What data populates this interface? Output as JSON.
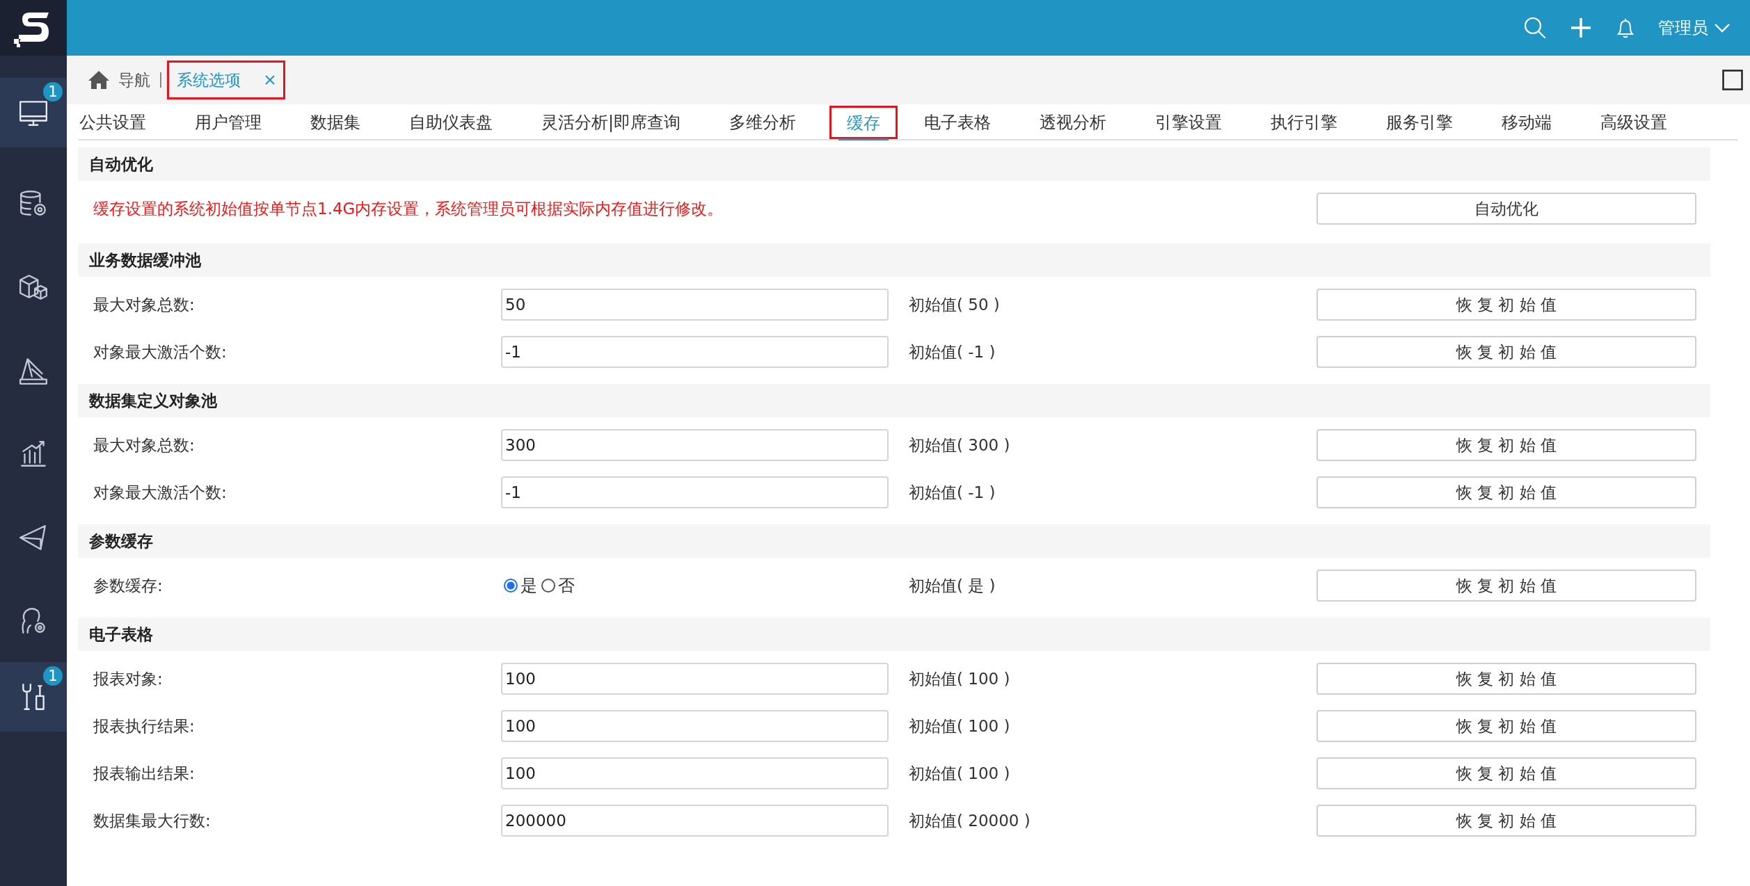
{
  "header": {
    "user": "管理员"
  },
  "sidebar": {
    "items": [
      {
        "kind": "monitor",
        "selected": true,
        "badge": "1"
      },
      {
        "kind": "database",
        "selected": false
      },
      {
        "kind": "cubes",
        "selected": false
      },
      {
        "kind": "design",
        "selected": false
      },
      {
        "kind": "chart",
        "selected": false
      },
      {
        "kind": "send",
        "selected": false
      },
      {
        "kind": "person",
        "selected": false
      },
      {
        "kind": "tools",
        "selected": true,
        "badge": "1"
      }
    ]
  },
  "page_tabs": [
    {
      "kind": "home",
      "label": "导航",
      "selected": false,
      "highlighted": false
    },
    {
      "kind": "closable",
      "label": "系统选项",
      "selected": true,
      "highlighted": true
    }
  ],
  "tabs": [
    {
      "label": "公共设置",
      "selected": false,
      "highlighted": false
    },
    {
      "label": "用户管理",
      "selected": false,
      "highlighted": false
    },
    {
      "label": "数据集",
      "selected": false,
      "highlighted": false
    },
    {
      "label": "自助仪表盘",
      "selected": false,
      "highlighted": false
    },
    {
      "label": "灵活分析|即席查询",
      "selected": false,
      "highlighted": false
    },
    {
      "label": "多维分析",
      "selected": false,
      "highlighted": false
    },
    {
      "label": "缓存",
      "selected": true,
      "highlighted": true
    },
    {
      "label": "电子表格",
      "selected": false,
      "highlighted": false
    },
    {
      "label": "透视分析",
      "selected": false,
      "highlighted": false
    },
    {
      "label": "引擎设置",
      "selected": false,
      "highlighted": false
    },
    {
      "label": "执行引擎",
      "selected": false,
      "highlighted": false
    },
    {
      "label": "服务引擎",
      "selected": false,
      "highlighted": false
    },
    {
      "label": "移动端",
      "selected": false,
      "highlighted": false
    },
    {
      "label": "高级设置",
      "selected": false,
      "highlighted": false
    }
  ],
  "sections": [
    {
      "title": "自动优化",
      "rows": [
        {
          "kind": "notice",
          "text": "缓存设置的系统初始值按单节点1.4G内存设置，系统管理员可根据实际内存值进行修改。",
          "button": "自动优化"
        }
      ]
    },
    {
      "title": "业务数据缓冲池",
      "rows": [
        {
          "kind": "input",
          "label": "最大对象总数:",
          "value": "50",
          "initial": "初始值( 50 )",
          "button": "恢 复 初 始 值"
        },
        {
          "kind": "input",
          "label": "对象最大激活个数:",
          "value": "-1",
          "initial": "初始值( -1 )",
          "button": "恢 复 初 始 值"
        }
      ]
    },
    {
      "title": "数据集定义对象池",
      "rows": [
        {
          "kind": "input",
          "label": "最大对象总数:",
          "value": "300",
          "initial": "初始值( 300 )",
          "button": "恢 复 初 始 值"
        },
        {
          "kind": "input",
          "label": "对象最大激活个数:",
          "value": "-1",
          "initial": "初始值( -1 )",
          "button": "恢 复 初 始 值"
        }
      ]
    },
    {
      "title": "参数缓存",
      "rows": [
        {
          "kind": "radio",
          "label": "参数缓存:",
          "options": [
            {
              "label": "是",
              "selected": true
            },
            {
              "label": "否",
              "selected": false
            }
          ],
          "initial": "初始值( 是 )",
          "button": "恢 复 初 始 值"
        }
      ]
    },
    {
      "title": "电子表格",
      "rows": [
        {
          "kind": "input",
          "label": "报表对象:",
          "value": "100",
          "initial": "初始值( 100 )",
          "button": "恢 复 初 始 值"
        },
        {
          "kind": "input",
          "label": "报表执行结果:",
          "value": "100",
          "initial": "初始值( 100 )",
          "button": "恢 复 初 始 值"
        },
        {
          "kind": "input",
          "label": "报表输出结果:",
          "value": "100",
          "initial": "初始值( 100 )",
          "button": "恢 复 初 始 值"
        },
        {
          "kind": "input",
          "label": "数据集最大行数:",
          "value": "200000",
          "initial": "初始值( 20000 )",
          "button": "恢 复 初 始 值"
        }
      ]
    }
  ]
}
